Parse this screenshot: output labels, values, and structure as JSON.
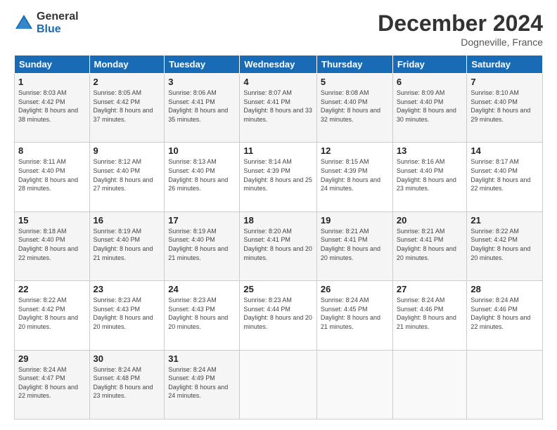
{
  "logo": {
    "general": "General",
    "blue": "Blue"
  },
  "header": {
    "month": "December 2024",
    "location": "Dogneville, France"
  },
  "weekdays": [
    "Sunday",
    "Monday",
    "Tuesday",
    "Wednesday",
    "Thursday",
    "Friday",
    "Saturday"
  ],
  "weeks": [
    [
      {
        "day": "1",
        "sunrise": "8:03 AM",
        "sunset": "4:42 PM",
        "daylight": "8 hours and 38 minutes."
      },
      {
        "day": "2",
        "sunrise": "8:05 AM",
        "sunset": "4:42 PM",
        "daylight": "8 hours and 37 minutes."
      },
      {
        "day": "3",
        "sunrise": "8:06 AM",
        "sunset": "4:41 PM",
        "daylight": "8 hours and 35 minutes."
      },
      {
        "day": "4",
        "sunrise": "8:07 AM",
        "sunset": "4:41 PM",
        "daylight": "8 hours and 33 minutes."
      },
      {
        "day": "5",
        "sunrise": "8:08 AM",
        "sunset": "4:40 PM",
        "daylight": "8 hours and 32 minutes."
      },
      {
        "day": "6",
        "sunrise": "8:09 AM",
        "sunset": "4:40 PM",
        "daylight": "8 hours and 30 minutes."
      },
      {
        "day": "7",
        "sunrise": "8:10 AM",
        "sunset": "4:40 PM",
        "daylight": "8 hours and 29 minutes."
      }
    ],
    [
      {
        "day": "8",
        "sunrise": "8:11 AM",
        "sunset": "4:40 PM",
        "daylight": "8 hours and 28 minutes."
      },
      {
        "day": "9",
        "sunrise": "8:12 AM",
        "sunset": "4:40 PM",
        "daylight": "8 hours and 27 minutes."
      },
      {
        "day": "10",
        "sunrise": "8:13 AM",
        "sunset": "4:40 PM",
        "daylight": "8 hours and 26 minutes."
      },
      {
        "day": "11",
        "sunrise": "8:14 AM",
        "sunset": "4:39 PM",
        "daylight": "8 hours and 25 minutes."
      },
      {
        "day": "12",
        "sunrise": "8:15 AM",
        "sunset": "4:39 PM",
        "daylight": "8 hours and 24 minutes."
      },
      {
        "day": "13",
        "sunrise": "8:16 AM",
        "sunset": "4:40 PM",
        "daylight": "8 hours and 23 minutes."
      },
      {
        "day": "14",
        "sunrise": "8:17 AM",
        "sunset": "4:40 PM",
        "daylight": "8 hours and 22 minutes."
      }
    ],
    [
      {
        "day": "15",
        "sunrise": "8:18 AM",
        "sunset": "4:40 PM",
        "daylight": "8 hours and 22 minutes."
      },
      {
        "day": "16",
        "sunrise": "8:19 AM",
        "sunset": "4:40 PM",
        "daylight": "8 hours and 21 minutes."
      },
      {
        "day": "17",
        "sunrise": "8:19 AM",
        "sunset": "4:40 PM",
        "daylight": "8 hours and 21 minutes."
      },
      {
        "day": "18",
        "sunrise": "8:20 AM",
        "sunset": "4:41 PM",
        "daylight": "8 hours and 20 minutes."
      },
      {
        "day": "19",
        "sunrise": "8:21 AM",
        "sunset": "4:41 PM",
        "daylight": "8 hours and 20 minutes."
      },
      {
        "day": "20",
        "sunrise": "8:21 AM",
        "sunset": "4:41 PM",
        "daylight": "8 hours and 20 minutes."
      },
      {
        "day": "21",
        "sunrise": "8:22 AM",
        "sunset": "4:42 PM",
        "daylight": "8 hours and 20 minutes."
      }
    ],
    [
      {
        "day": "22",
        "sunrise": "8:22 AM",
        "sunset": "4:42 PM",
        "daylight": "8 hours and 20 minutes."
      },
      {
        "day": "23",
        "sunrise": "8:23 AM",
        "sunset": "4:43 PM",
        "daylight": "8 hours and 20 minutes."
      },
      {
        "day": "24",
        "sunrise": "8:23 AM",
        "sunset": "4:43 PM",
        "daylight": "8 hours and 20 minutes."
      },
      {
        "day": "25",
        "sunrise": "8:23 AM",
        "sunset": "4:44 PM",
        "daylight": "8 hours and 20 minutes."
      },
      {
        "day": "26",
        "sunrise": "8:24 AM",
        "sunset": "4:45 PM",
        "daylight": "8 hours and 21 minutes."
      },
      {
        "day": "27",
        "sunrise": "8:24 AM",
        "sunset": "4:46 PM",
        "daylight": "8 hours and 21 minutes."
      },
      {
        "day": "28",
        "sunrise": "8:24 AM",
        "sunset": "4:46 PM",
        "daylight": "8 hours and 22 minutes."
      }
    ],
    [
      {
        "day": "29",
        "sunrise": "8:24 AM",
        "sunset": "4:47 PM",
        "daylight": "8 hours and 22 minutes."
      },
      {
        "day": "30",
        "sunrise": "8:24 AM",
        "sunset": "4:48 PM",
        "daylight": "8 hours and 23 minutes."
      },
      {
        "day": "31",
        "sunrise": "8:24 AM",
        "sunset": "4:49 PM",
        "daylight": "8 hours and 24 minutes."
      },
      null,
      null,
      null,
      null
    ]
  ],
  "labels": {
    "sunrise": "Sunrise:",
    "sunset": "Sunset:",
    "daylight": "Daylight:"
  }
}
